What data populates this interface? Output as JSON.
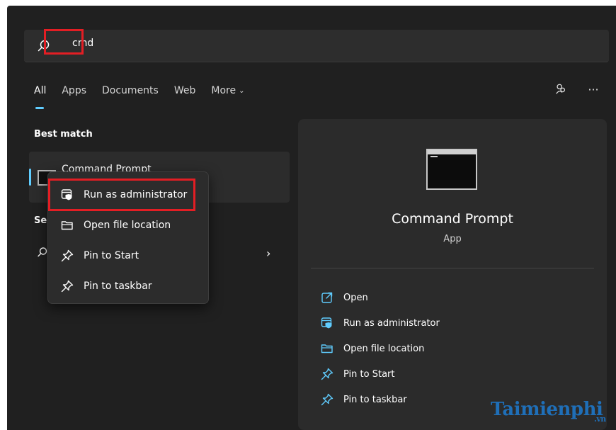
{
  "search": {
    "value": "cmd"
  },
  "tabs": [
    {
      "label": "All",
      "active": true
    },
    {
      "label": "Apps"
    },
    {
      "label": "Documents"
    },
    {
      "label": "Web"
    },
    {
      "label": "More"
    }
  ],
  "top_icons": [
    "share-icon",
    "more-options-icon"
  ],
  "best_match": {
    "heading": "Best match",
    "result_title": "Command Prompt"
  },
  "settings_section": {
    "heading": "Se"
  },
  "context_menu": {
    "items": [
      {
        "label": "Run as administrator",
        "icon": "shield-window-icon"
      },
      {
        "label": "Open file location",
        "icon": "folder-icon"
      },
      {
        "label": "Pin to Start",
        "icon": "pin-icon"
      },
      {
        "label": "Pin to taskbar",
        "icon": "pin-icon"
      }
    ]
  },
  "preview": {
    "title": "Command Prompt",
    "subtitle": "App",
    "actions": [
      {
        "label": "Open",
        "icon": "open-external-icon"
      },
      {
        "label": "Run as administrator",
        "icon": "shield-window-icon"
      },
      {
        "label": "Open file location",
        "icon": "folder-icon"
      },
      {
        "label": "Pin to Start",
        "icon": "pin-icon"
      },
      {
        "label": "Pin to taskbar",
        "icon": "pin-icon"
      }
    ]
  },
  "watermark": {
    "text": "Taimienphi",
    "suffix": ".vn"
  },
  "colors": {
    "accent": "#60cdff",
    "highlight": "#e31e24",
    "background": "#202020"
  }
}
